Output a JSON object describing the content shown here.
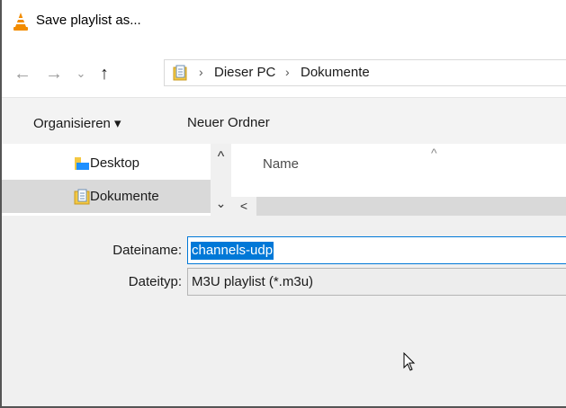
{
  "window": {
    "title": "Save playlist as..."
  },
  "nav": {
    "back_glyph": "←",
    "forward_glyph": "→",
    "recent_glyph": "⌄",
    "up_glyph": "↑"
  },
  "address": {
    "separator": "›",
    "crumbs": [
      "Dieser PC",
      "Dokumente"
    ]
  },
  "toolbar": {
    "organize_label": "Organisieren ▾",
    "new_folder_label": "Neuer Ordner"
  },
  "navpane": {
    "items": [
      {
        "label": "Desktop",
        "icon": "desktop-folder-icon",
        "selected": false
      },
      {
        "label": "Dokumente",
        "icon": "documents-folder-icon",
        "selected": true
      }
    ],
    "scroll_up": "^",
    "scroll_down": "⌄"
  },
  "filelist": {
    "column_name": "Name",
    "sort_indicator": "^",
    "hscroll_left": "<"
  },
  "form": {
    "filename_label": "Dateiname:",
    "filename_value": "channels-udp",
    "filetype_label": "Dateityp:",
    "filetype_value": "M3U playlist (*.m3u)"
  },
  "colors": {
    "accent": "#0078d7",
    "vlc_orange": "#f28c00",
    "selected_bg": "#d9d9d9",
    "footer_bg": "#f0f0f0"
  }
}
